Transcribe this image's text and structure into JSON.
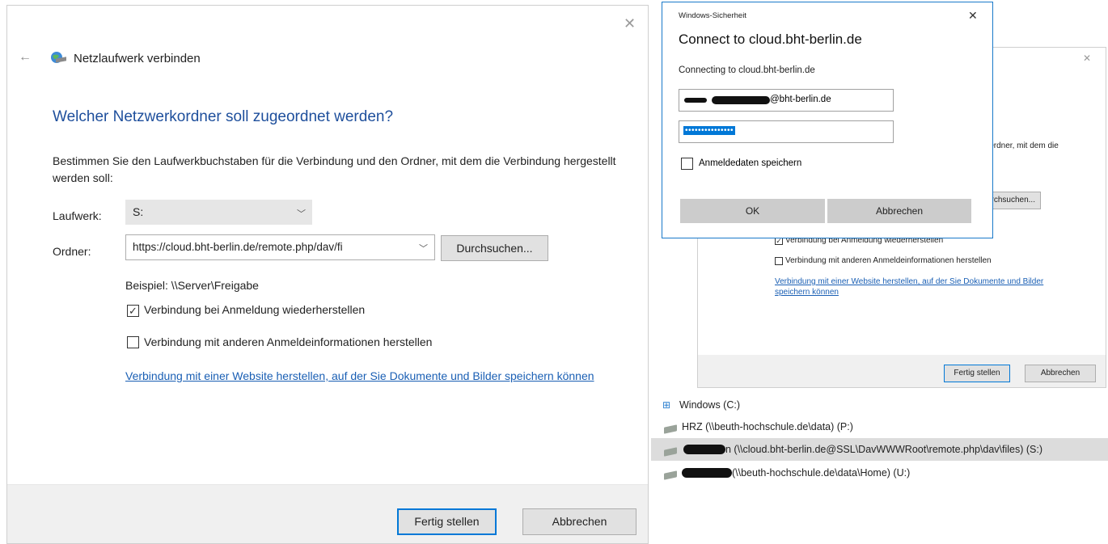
{
  "map_dialog": {
    "title": "Netzlaufwerk verbinden",
    "heading": "Welcher Netzwerkordner soll zugeordnet werden?",
    "description": "Bestimmen Sie den Laufwerkbuchstaben für die Verbindung und den Ordner, mit dem die Verbindung hergestellt werden soll:",
    "drive_label": "Laufwerk:",
    "drive_value": "S:",
    "folder_label": "Ordner:",
    "folder_value": "https://cloud.bht-berlin.de/remote.php/dav/fi",
    "browse_label": "Durchsuchen...",
    "example_text": "Beispiel: \\\\Server\\Freigabe",
    "reconnect_label": "Verbindung bei Anmeldung wiederherstellen",
    "reconnect_checked": true,
    "other_credentials_label": "Verbindung mit anderen Anmeldeinformationen herstellen",
    "other_credentials_checked": false,
    "website_link": "Verbindung mit einer Website herstellen, auf der Sie Dokumente und Bilder speichern können",
    "finish_label": "Fertig stellen",
    "cancel_label": "Abbrechen"
  },
  "background_dialog": {
    "partial_description": "Ordner, mit dem die",
    "partial_browse": "rchsuchen...",
    "reconnect_label": "Verbindung bei Anmeldung wiederherstellen",
    "other_credentials_label": "Verbindung mit anderen Anmeldeinformationen herstellen",
    "website_link": "Verbindung mit einer Website herstellen, auf der Sie Dokumente und Bilder speichern können",
    "finish_label": "Fertig stellen",
    "cancel_label": "Abbrechen"
  },
  "security_dialog": {
    "window_title": "Windows-Sicherheit",
    "heading": "Connect to cloud.bht-berlin.de",
    "subtitle": "Connecting to cloud.bht-berlin.de",
    "username_suffix": "@bht-berlin.de",
    "password_mask": "•••••••••••••••",
    "remember_label": "Anmeldedaten speichern",
    "ok_label": "OK",
    "cancel_label": "Abbrechen"
  },
  "drives": [
    {
      "label": "Windows (C:)",
      "icon": "windows-drive-icon"
    },
    {
      "label": "HRZ (\\\\beuth-hochschule.de\\data) (P:)",
      "icon": "network-drive-icon"
    },
    {
      "label": "n (\\\\cloud.bht-berlin.de@SSL\\DavWWWRoot\\remote.php\\dav\\files) (S:)",
      "icon": "network-drive-icon"
    },
    {
      "label": "(\\\\beuth-hochschule.de\\data\\Home) (U:)",
      "icon": "network-drive-icon"
    }
  ],
  "colors": {
    "accent": "#0078d7",
    "heading": "#1e4f9c",
    "link": "#1a5fb4",
    "selected_row": "#dcdcdc"
  }
}
